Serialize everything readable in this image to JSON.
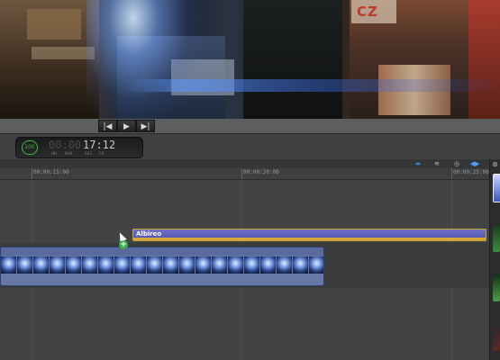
{
  "viewer": {
    "storefront_sign": "CZ"
  },
  "transport": {
    "rewind_icon": "skip-back-icon",
    "play_icon": "play-icon",
    "forward_icon": "skip-forward-icon"
  },
  "dashboard": {
    "percent": "100",
    "timecode_dim": "00:00",
    "timecode_lit": "17:12",
    "labels": [
      "HR",
      "MIN",
      "SEC",
      "FR"
    ]
  },
  "timeline": {
    "ruler_labels": [
      "00:00:15:00",
      "00:00:20:00",
      "00:00:25:00"
    ],
    "title_clip_label": "Albireo"
  },
  "colors": {
    "accent_blue": "#4aa0ff",
    "title_clip": "#5b5fb8",
    "title_clip_border": "#c7a22f",
    "video_clip": "#6878a6",
    "add_badge": "#3db14a"
  }
}
